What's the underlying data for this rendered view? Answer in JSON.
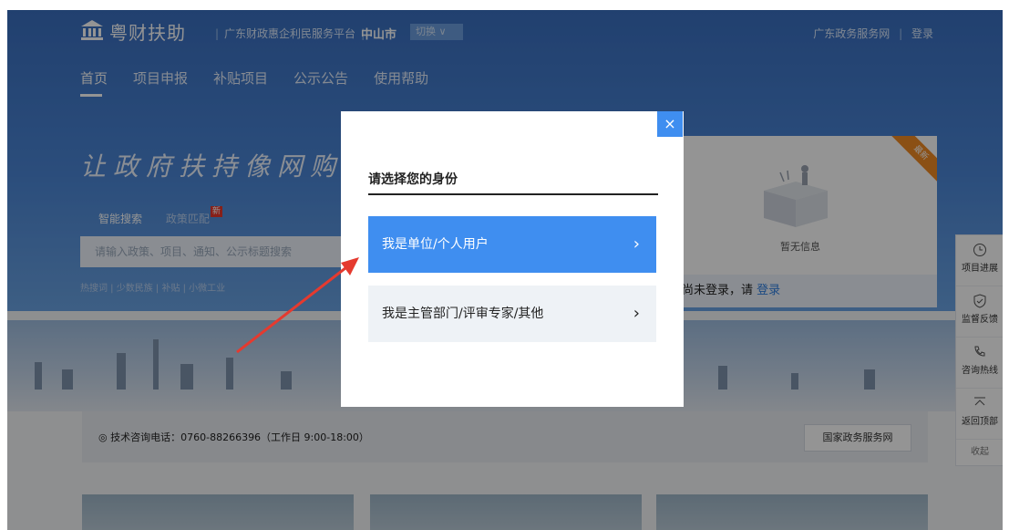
{
  "header": {
    "logo_text": "粤财扶助",
    "platform": "广东财政惠企利民服务平台",
    "city": "中山市",
    "switch_label": "切换 ∨",
    "top_links": [
      "广东政务服务网",
      "登录"
    ]
  },
  "nav": [
    "首页",
    "项目申报",
    "补贴项目",
    "公示公告",
    "使用帮助"
  ],
  "hero": {
    "slogan": "让政府扶持像网购一样",
    "search_tabs": [
      "智能搜索",
      "政策匹配"
    ],
    "new_badge": "新",
    "search_placeholder": "请输入政策、项目、通知、公示标题搜索",
    "hotwords": "热搜词 | 少数民族 | 补贴 | 小微工业"
  },
  "notice_card": {
    "ribbon": "最新",
    "empty_text": "暂无信息",
    "login_prompt": "尚未登录，请",
    "login_link": "登录"
  },
  "hotline": {
    "text": "技术咨询电话：0760-88266396（工作日 9:00-18:00）",
    "gov_button": "国家政务服务网"
  },
  "sidebar": {
    "items": [
      "项目进展",
      "监督反馈",
      "咨询热线",
      "返回顶部"
    ],
    "collapse": "收起"
  },
  "modal": {
    "close": "×",
    "title": "请选择您的身份",
    "options": [
      "我是单位/个人用户",
      "我是主管部门/评审专家/其他"
    ],
    "chevron": "›"
  },
  "colors": {
    "primary": "#3f8ef0",
    "header": "#3a6fc0",
    "accent_orange": "#f08a24"
  }
}
